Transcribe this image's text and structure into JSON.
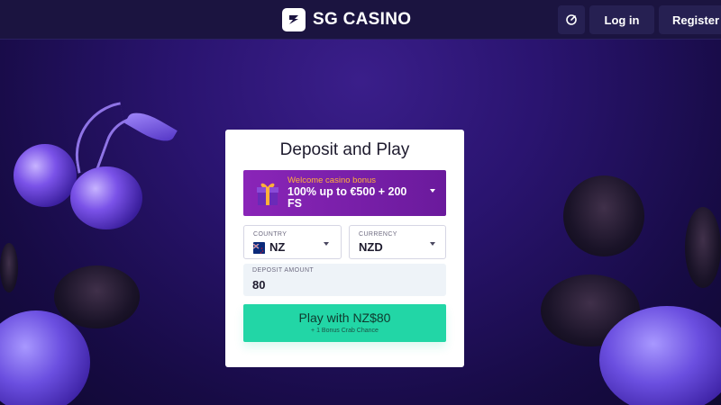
{
  "header": {
    "brand": "SG CASINO",
    "support_icon": "chat-icon",
    "login_label": "Log in",
    "register_label": "Register"
  },
  "card": {
    "title": "Deposit and Play",
    "bonus": {
      "icon": "gift-icon",
      "subtitle": "Welcome casino bonus",
      "text": "100% up to €500 + 200 FS"
    },
    "country": {
      "label": "COUNTRY",
      "value": "NZ",
      "flag_icon": "nz-flag-icon"
    },
    "currency": {
      "label": "CURRENCY",
      "value": "NZD"
    },
    "deposit": {
      "label": "DEPOSIT AMOUNT",
      "value": "80"
    },
    "play_button": {
      "label": "Play with NZ$80",
      "sublabel": "+ 1 Bonus Crab Chance"
    }
  },
  "colors": {
    "accent": "#22d6a6",
    "bonus_bg": "#8a25b8",
    "bonus_highlight": "#ffb03a",
    "header_bg": "#1b1440"
  }
}
